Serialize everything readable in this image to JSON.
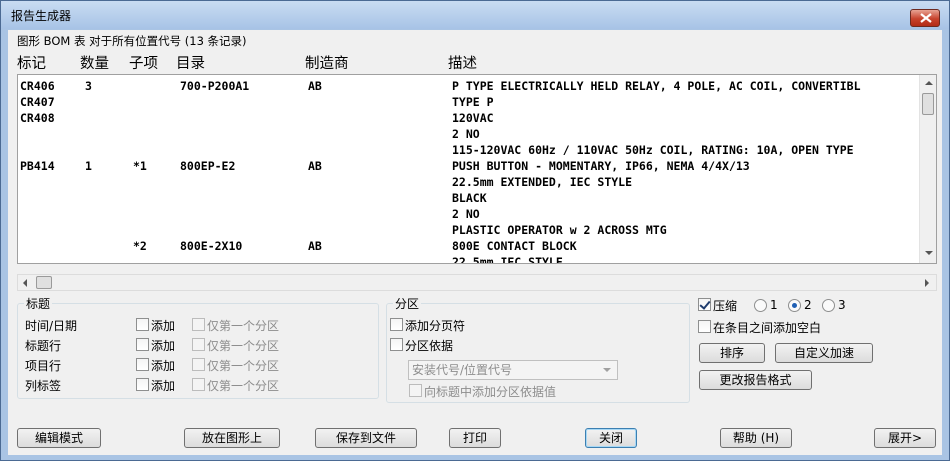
{
  "window": {
    "title": "报告生成器"
  },
  "subtitle": "图形 BOM 表 对于所有位置代号 (13 条记录)",
  "columns": [
    "标记",
    "数量",
    "子项",
    "目录",
    "制造商",
    "描述"
  ],
  "rows": [
    [
      "CR406",
      "3",
      "",
      "700-P200A1",
      "AB",
      "P TYPE ELECTRICALLY HELD RELAY, 4 POLE, AC COIL, CONVERTIBL"
    ],
    [
      "CR407",
      "",
      "",
      "",
      "",
      "TYPE P"
    ],
    [
      "CR408",
      "",
      "",
      "",
      "",
      "120VAC"
    ],
    [
      "",
      "",
      "",
      "",
      "",
      "2 NO"
    ],
    [
      "",
      "",
      "",
      "",
      "",
      "115-120VAC 60Hz / 110VAC 50Hz COIL, RATING: 10A, OPEN TYPE"
    ],
    [
      "PB414",
      "1",
      "*1",
      "800EP-E2",
      "AB",
      "PUSH BUTTON - MOMENTARY, IP66, NEMA 4/4X/13"
    ],
    [
      "",
      "",
      "",
      "",
      "",
      "22.5mm EXTENDED, IEC STYLE"
    ],
    [
      "",
      "",
      "",
      "",
      "",
      "BLACK"
    ],
    [
      "",
      "",
      "",
      "",
      "",
      "2 NO"
    ],
    [
      "",
      "",
      "",
      "",
      "",
      "PLASTIC OPERATOR w 2 ACROSS MTG"
    ],
    [
      "",
      "",
      "*2",
      "800E-2X10",
      "AB",
      "800E CONTACT BLOCK"
    ],
    [
      "",
      "",
      "",
      "",
      "",
      "22.5mm IEC STYLE"
    ]
  ],
  "title_group": {
    "label": "标题",
    "rows": [
      {
        "label": "时间/日期",
        "add": "添加",
        "first_only": "仅第一个分区"
      },
      {
        "label": "标题行",
        "add": "添加",
        "first_only": "仅第一个分区"
      },
      {
        "label": "项目行",
        "add": "添加",
        "first_only": "仅第一个分区"
      },
      {
        "label": "列标签",
        "add": "添加",
        "first_only": "仅第一个分区"
      }
    ]
  },
  "section_group": {
    "label": "分区",
    "add_page_break": "添加分页符",
    "section_by": "分区依据",
    "combo_value": "安装代号/位置代号",
    "add_to_title": "向标题中添加分区依据值"
  },
  "options": {
    "compress": "压缩",
    "compress_checked": true,
    "radios": [
      "1",
      "2",
      "3"
    ],
    "selected_radio": "2",
    "blank_line": "在条目之间添加空白",
    "sort": "排序",
    "custom_speed": "自定义加速",
    "change_format": "更改报告格式"
  },
  "footer": {
    "edit_mode": "编辑模式",
    "place_on_drawing": "放在图形上",
    "save_to_file": "保存到文件",
    "print": "打印",
    "close": "关闭",
    "help": "帮助 (H)",
    "expand": "展开>"
  }
}
